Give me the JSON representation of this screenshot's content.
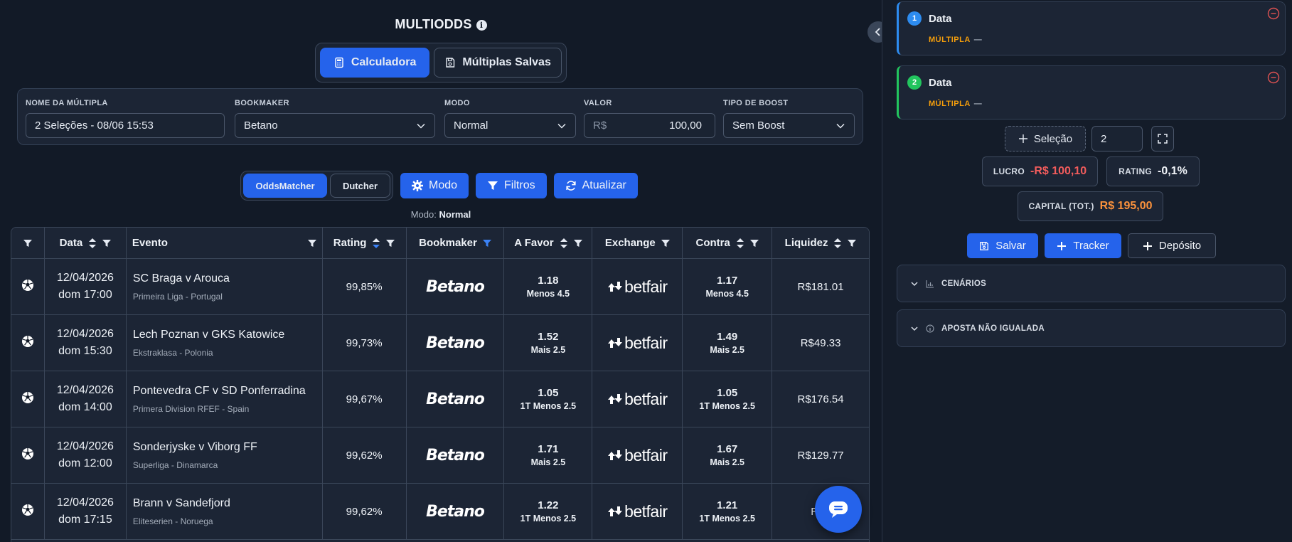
{
  "page": {
    "title": "MULTIODDS"
  },
  "tabs": {
    "calculadora": "Calculadora",
    "salvas": "Múltiplas Salvas"
  },
  "form": {
    "nome_label": "NOME DA MÚLTIPLA",
    "nome_value": "2 Seleções - 08/06 15:53",
    "bookmaker_label": "BOOKMAKER",
    "bookmaker_value": "Betano",
    "modo_label": "MODO",
    "modo_value": "Normal",
    "valor_label": "VALOR",
    "valor_currency": "R$",
    "valor_value": "100,00",
    "boost_label": "TIPO DE BOOST",
    "boost_value": "Sem Boost"
  },
  "toolbar": {
    "oddsmatcher": "OddsMatcher",
    "dutcher": "Dutcher",
    "modo": "Modo",
    "filtros": "Filtros",
    "atualizar": "Atualizar",
    "modo_prefix": "Modo:",
    "modo_current": "Normal"
  },
  "table": {
    "headers": [
      "Data",
      "Evento",
      "Rating",
      "Bookmaker",
      "A Favor",
      "Exchange",
      "Contra",
      "Liquidez"
    ],
    "rows": [
      {
        "date": "12/04/2026",
        "time": "dom 17:00",
        "event": "SC Braga v Arouca",
        "league": "Primeira Liga - Portugal",
        "rating": "99,85%",
        "bookmaker": "Betano",
        "favor_odd": "1.18",
        "favor_market": "Menos 4.5",
        "exchange": "betfair",
        "contra_odd": "1.17",
        "contra_market": "Menos 4.5",
        "liquidez": "R$181.01"
      },
      {
        "date": "12/04/2026",
        "time": "dom 15:30",
        "event": "Lech Poznan v GKS Katowice",
        "league": "Ekstraklasa - Polonia",
        "rating": "99,73%",
        "bookmaker": "Betano",
        "favor_odd": "1.52",
        "favor_market": "Mais 2.5",
        "exchange": "betfair",
        "contra_odd": "1.49",
        "contra_market": "Mais 2.5",
        "liquidez": "R$49.33"
      },
      {
        "date": "12/04/2026",
        "time": "dom 14:00",
        "event": "Pontevedra CF v SD Ponferradina",
        "league": "Primera Division RFEF - Spain",
        "rating": "99,67%",
        "bookmaker": "Betano",
        "favor_odd": "1.05",
        "favor_market": "1T Menos 2.5",
        "exchange": "betfair",
        "contra_odd": "1.05",
        "contra_market": "1T Menos 2.5",
        "liquidez": "R$176.54"
      },
      {
        "date": "12/04/2026",
        "time": "dom 12:00",
        "event": "Sonderjyske v Viborg FF",
        "league": "Superliga - Dinamarca",
        "rating": "99,62%",
        "bookmaker": "Betano",
        "favor_odd": "1.71",
        "favor_market": "Mais 2.5",
        "exchange": "betfair",
        "contra_odd": "1.67",
        "contra_market": "Mais 2.5",
        "liquidez": "R$129.77"
      },
      {
        "date": "12/04/2026",
        "time": "dom 17:15",
        "event": "Brann v Sandefjord",
        "league": "Eliteserien - Noruega",
        "rating": "99,62%",
        "bookmaker": "Betano",
        "favor_odd": "1.22",
        "favor_market": "1T Menos 2.5",
        "exchange": "betfair",
        "contra_odd": "1.21",
        "contra_market": "1T Menos 2.5",
        "liquidez": "R$2"
      }
    ]
  },
  "selections": [
    {
      "num": "1",
      "name": "Data",
      "tag": "MÚLTIPLA",
      "dash": "—"
    },
    {
      "num": "2",
      "name": "Data",
      "tag": "MÚLTIPLA",
      "dash": "—"
    }
  ],
  "controls": {
    "add_selection": "Seleção",
    "count": "2"
  },
  "stats": {
    "lucro_label": "LUCRO",
    "lucro_value": "-R$ 100,10",
    "rating_label": "RATING",
    "rating_value": "-0,1%",
    "capital_label": "CAPITAL (TOT.)",
    "capital_value": "R$ 195,00"
  },
  "actions": {
    "salvar": "Salvar",
    "tracker": "Tracker",
    "deposito": "Depósito"
  },
  "accordions": {
    "cenarios": "CENÁRIOS",
    "aposta": "APOSTA NÃO IGUALADA"
  },
  "colors": {
    "accent": "#2563eb",
    "negative": "#f25c5c",
    "capital": "#fb923c",
    "tag": "#f59e0b",
    "sel1": "#2d8cf0",
    "sel2": "#22c55e"
  },
  "icons": {
    "sport": "soccer-ball-icon",
    "chat": "chat-icon",
    "collapse": "chevron-left-icon"
  }
}
